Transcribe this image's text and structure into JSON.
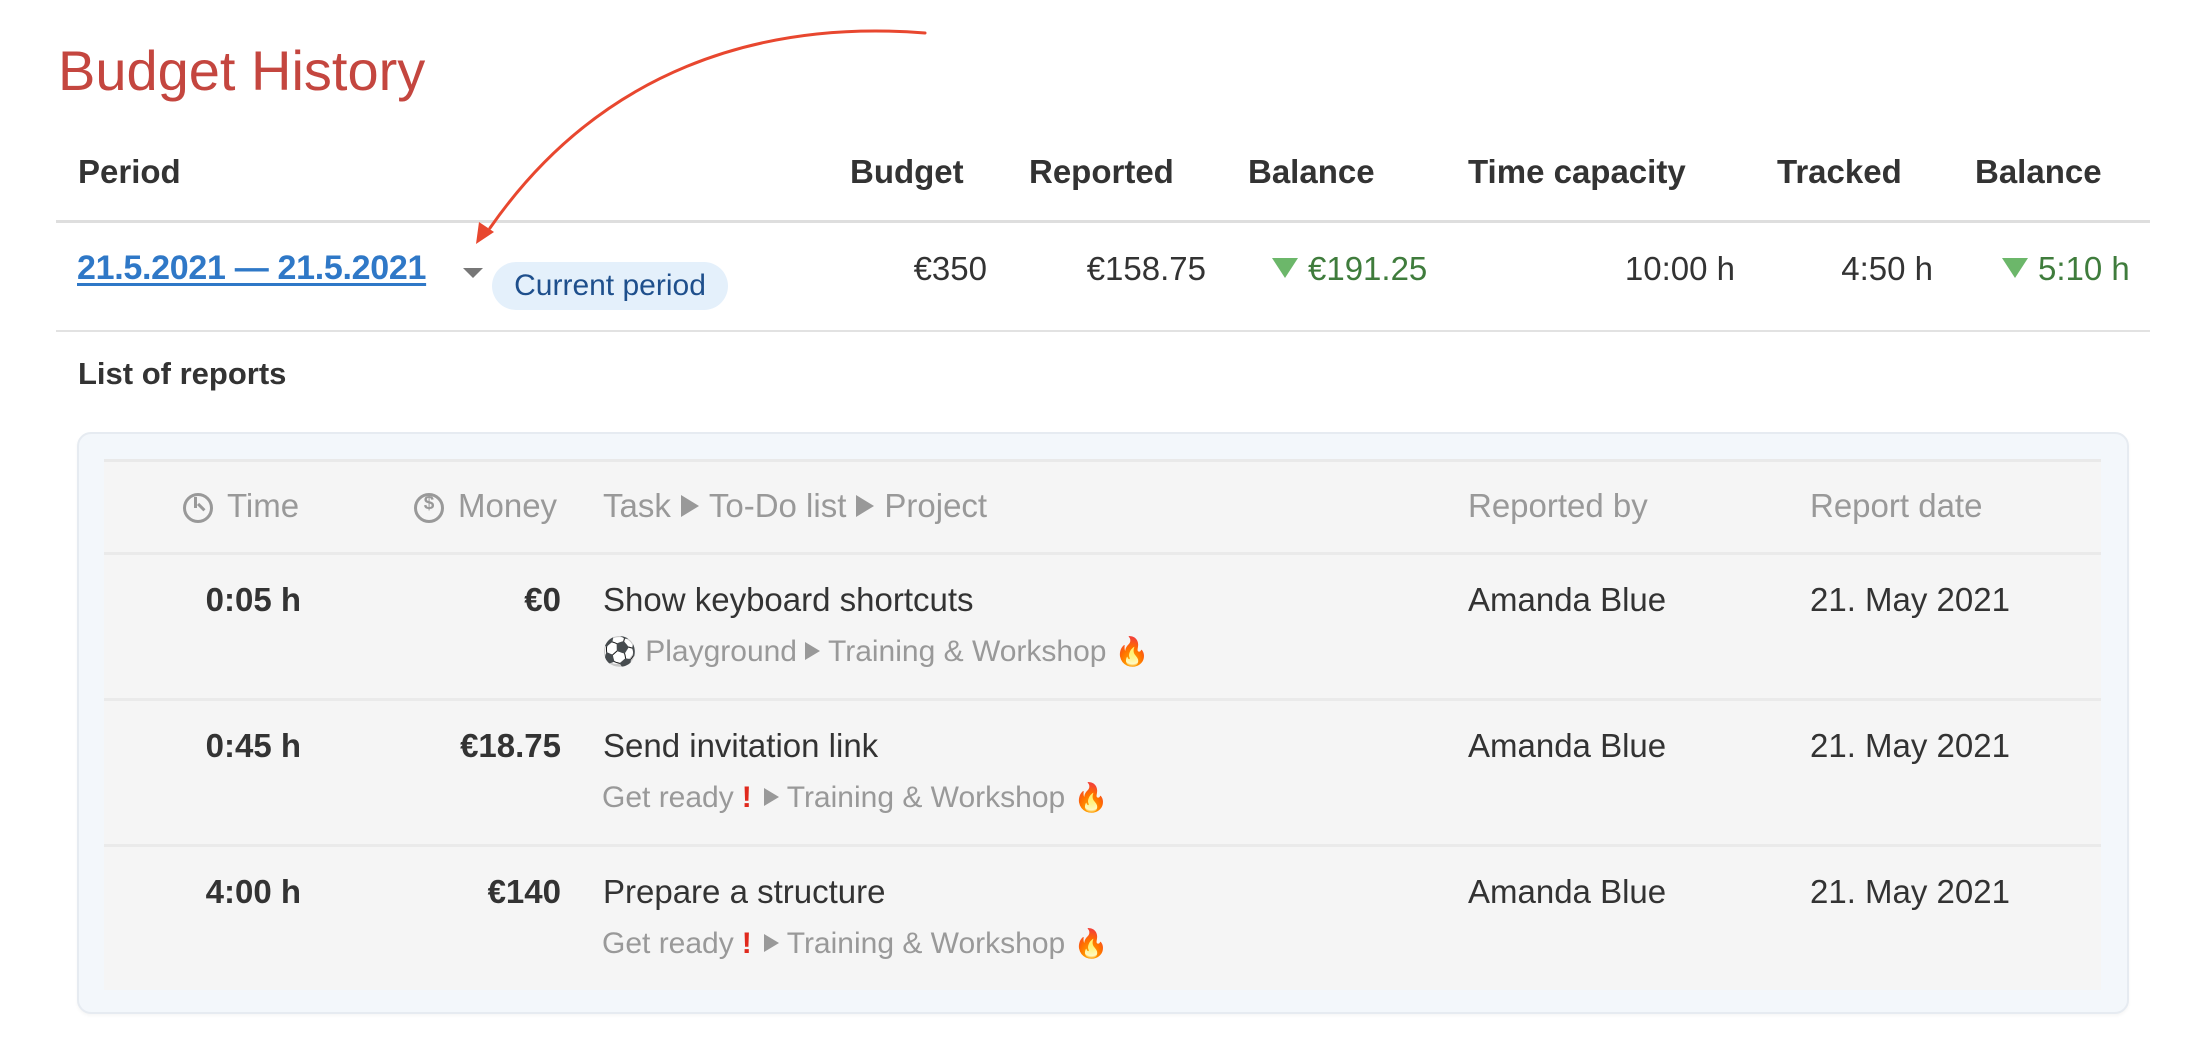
{
  "page": {
    "title": "Budget History"
  },
  "summary_table": {
    "headers": {
      "period": "Period",
      "budget": "Budget",
      "reported": "Reported",
      "balance_money": "Balance",
      "time_capacity": "Time capacity",
      "tracked": "Tracked",
      "balance_time": "Balance"
    },
    "row": {
      "period": "21.5.2021 — 21.5.2021",
      "current_badge": "Current period",
      "budget": "€350",
      "reported": "€158.75",
      "balance_money": "€191.25",
      "balance_money_trend": "down",
      "time_capacity": "10:00 h",
      "tracked": "4:50 h",
      "balance_time": "5:10 h",
      "balance_time_trend": "down"
    }
  },
  "reports": {
    "section_title": "List of reports",
    "headers": {
      "time": "Time",
      "time_icon": "clock-icon",
      "money": "Money",
      "money_icon": "dollar-circle-icon",
      "task": "Task",
      "todo_list": "To-Do list",
      "project": "Project",
      "separator_icon": "triangle-right-icon",
      "reported_by": "Reported by",
      "report_date": "Report date"
    },
    "rows": [
      {
        "time": "0:05 h",
        "money": "€0",
        "task": "Show keyboard shortcuts",
        "todo_emoji": "⚽",
        "todo_list": "Playground",
        "todo_mark": "",
        "project": "Training & Workshop",
        "project_emoji": "🔥",
        "reported_by": "Amanda Blue",
        "report_date": "21. May 2021"
      },
      {
        "time": "0:45 h",
        "money": "€18.75",
        "task": "Send invitation link",
        "todo_emoji": "",
        "todo_list": "Get ready",
        "todo_mark": "!",
        "project": "Training & Workshop",
        "project_emoji": "🔥",
        "reported_by": "Amanda Blue",
        "report_date": "21. May 2021"
      },
      {
        "time": "4:00 h",
        "money": "€140",
        "task": "Prepare a structure",
        "todo_emoji": "",
        "todo_list": "Get ready",
        "todo_mark": "!",
        "project": "Training & Workshop",
        "project_emoji": "🔥",
        "reported_by": "Amanda Blue",
        "report_date": "21. May 2021"
      }
    ]
  },
  "annotation": {
    "type": "curved-arrow",
    "color": "#e8472f",
    "points_to": "period-dropdown-caret"
  },
  "colors": {
    "title": "#c4463f",
    "link": "#2f78c7",
    "positive_balance": "#3f7c3c",
    "trend_icon": "#6cb76a",
    "badge_bg": "#e4f0fb",
    "badge_text": "#1e4f8c",
    "alert": "#e0291d"
  }
}
